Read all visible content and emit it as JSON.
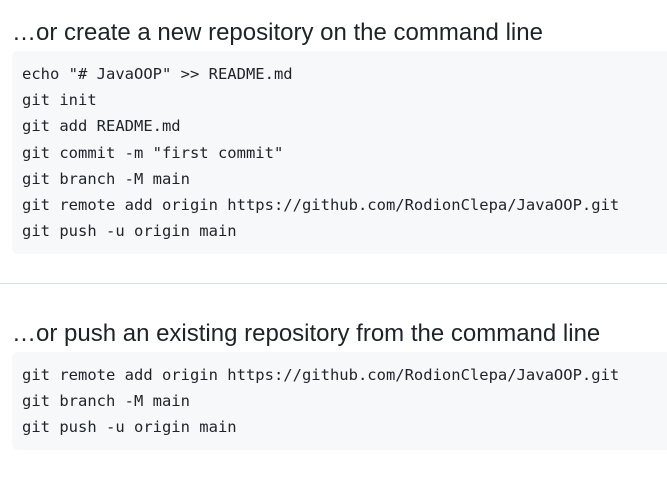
{
  "new_repo": {
    "title": "…or create a new repository on the command line",
    "lines": [
      "echo \"# JavaOOP\" >> README.md",
      "git init",
      "git add README.md",
      "git commit -m \"first commit\"",
      "git branch -M main",
      "git remote add origin https://github.com/RodionClepa/JavaOOP.git",
      "git push -u origin main"
    ]
  },
  "existing_repo": {
    "title": "…or push an existing repository from the command line",
    "lines": [
      "git remote add origin https://github.com/RodionClepa/JavaOOP.git",
      "git branch -M main",
      "git push -u origin main"
    ]
  }
}
